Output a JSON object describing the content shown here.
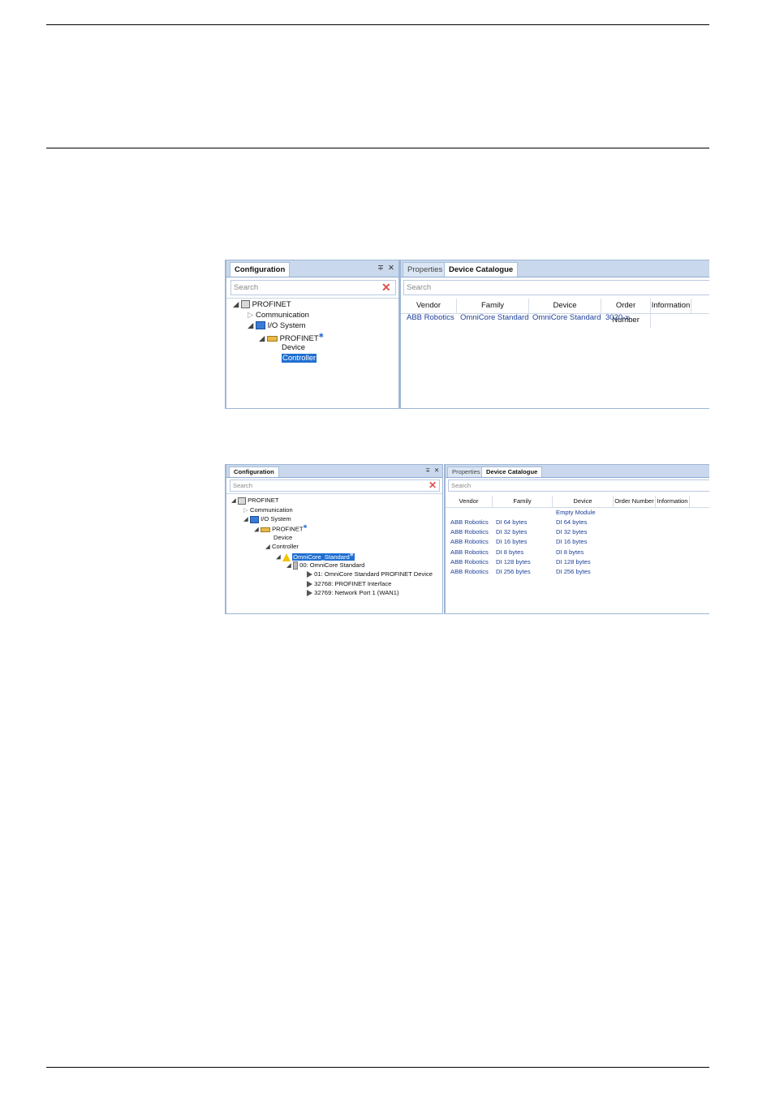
{
  "figure1": {
    "config_panel": {
      "tab_label": "Configuration",
      "pin_glyph": "∓",
      "close_glyph": "✕",
      "search_placeholder": "Search",
      "tree": {
        "root": "PROFINET",
        "communication": "Communication",
        "io_system": "I/O System",
        "profinet": "PROFINET",
        "device": "Device",
        "controller": "Controller"
      }
    },
    "catalog_panel": {
      "tabs": [
        "Properties",
        "Device Catalogue"
      ],
      "search_placeholder": "Search",
      "columns": [
        "Vendor",
        "Family",
        "Device",
        "Order Number",
        "Information"
      ],
      "rows": [
        [
          "ABB Robotics",
          "OmniCore Standard",
          "OmniCore Standard",
          "3020-x",
          ""
        ]
      ]
    }
  },
  "figure2": {
    "config_panel": {
      "tab_label": "Configuration",
      "pin_glyph": "∓",
      "close_glyph": "✕",
      "search_placeholder": "Search",
      "tree": {
        "root": "PROFINET",
        "communication": "Communication",
        "io_system": "I/O System",
        "profinet": "PROFINET",
        "device": "Device",
        "controller": "Controller",
        "omnicore": "OmniCore_Standard",
        "slot0": "00: OmniCore Standard",
        "slot1": "01: OmniCore Standard PROFINET Device",
        "slot2": "32768: PROFINET Interface",
        "slot3": "32769: Network Port 1 (WAN1)"
      }
    },
    "catalog_panel": {
      "tabs": [
        "Properties",
        "Device Catalogue"
      ],
      "search_placeholder": "Search",
      "columns": [
        "Vendor",
        "Family",
        "Device",
        "Order Number",
        "Information"
      ],
      "empty_module": "Empty Module",
      "rows": [
        [
          "ABB Robotics",
          "DI 64 bytes",
          "DI 64 bytes"
        ],
        [
          "ABB Robotics",
          "DI 32 bytes",
          "DI 32 bytes"
        ],
        [
          "ABB Robotics",
          "DI 16 bytes",
          "DI 16 bytes"
        ],
        [
          "ABB Robotics",
          "DI 8 bytes",
          "DI 8 bytes"
        ],
        [
          "ABB Robotics",
          "DI 128 bytes",
          "DI 128 bytes"
        ],
        [
          "ABB Robotics",
          "DI 256 bytes",
          "DI 256 bytes"
        ]
      ]
    }
  },
  "colors": {
    "selection": "#1f6fd1",
    "link_text": "#1c3f9b",
    "tab_strip": "#c9d8ec"
  }
}
